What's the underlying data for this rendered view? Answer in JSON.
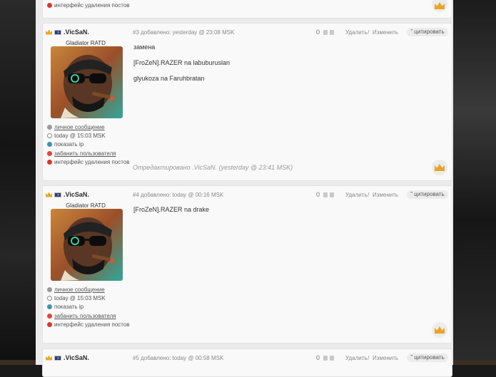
{
  "posts": [
    {
      "partial": true,
      "meta": [
        {
          "icon": "delete-icon",
          "text": "интерфейс удаления постов",
          "link": false
        }
      ]
    },
    {
      "author": {
        "nick": ".VicSaN.",
        "rank": "Gladiator RATD"
      },
      "number_info": "#3 добавлено: yesterday @ 23:08 MSK",
      "score": "0",
      "delete_label": "Удалить",
      "slash": "/",
      "edit_label": "Изменить",
      "quote_label": "” цитировать",
      "lines": [
        "замена",
        "[FroZeN].RAZER na labuburuslan",
        "glyukoza na Faruhbratan"
      ],
      "edited": "Отредактировано .VicSaN. (yesterday @ 23:41 MSK)",
      "meta": [
        {
          "icon": "message-icon",
          "text": "личное сообщение",
          "link": true
        },
        {
          "icon": "clock-icon",
          "text": "today @ 15:03 MSK",
          "link": false
        },
        {
          "icon": "ip-icon",
          "text": "показать ip",
          "link": false
        },
        {
          "icon": "ban-icon",
          "text": "забанить пользователя",
          "link": true
        },
        {
          "icon": "delete-icon",
          "text": "интерфейс удаления постов",
          "link": false
        }
      ]
    },
    {
      "author": {
        "nick": ".VicSaN.",
        "rank": "Gladiator RATD"
      },
      "number_info": "#4 добавлено: today @ 00:16 MSK",
      "score": "0",
      "delete_label": "Удалить",
      "slash": "/",
      "edit_label": "Изменить",
      "quote_label": "” цитировать",
      "lines": [
        "[FroZeN].RAZER na drake"
      ],
      "meta": [
        {
          "icon": "message-icon",
          "text": "личное сообщение",
          "link": true
        },
        {
          "icon": "clock-icon",
          "text": "today @ 15:03 MSK",
          "link": false
        },
        {
          "icon": "ip-icon",
          "text": "показать ip",
          "link": false
        },
        {
          "icon": "ban-icon",
          "text": "забанить пользователя",
          "link": true
        },
        {
          "icon": "delete-icon",
          "text": "интерфейс удаления постов",
          "link": false
        }
      ]
    },
    {
      "author": {
        "nick": ".VicSaN."
      },
      "number_info": "#5 добавлено: today @ 00:58 MSK",
      "score": "0",
      "delete_label": "Удалить",
      "slash": "/",
      "edit_label": "Изменить",
      "quote_label": "” цитировать"
    }
  ],
  "colors": {
    "accent_crown": "#e7a427",
    "link": "#555555",
    "ban": "#e2463b",
    "ip": "#3f93a8"
  }
}
